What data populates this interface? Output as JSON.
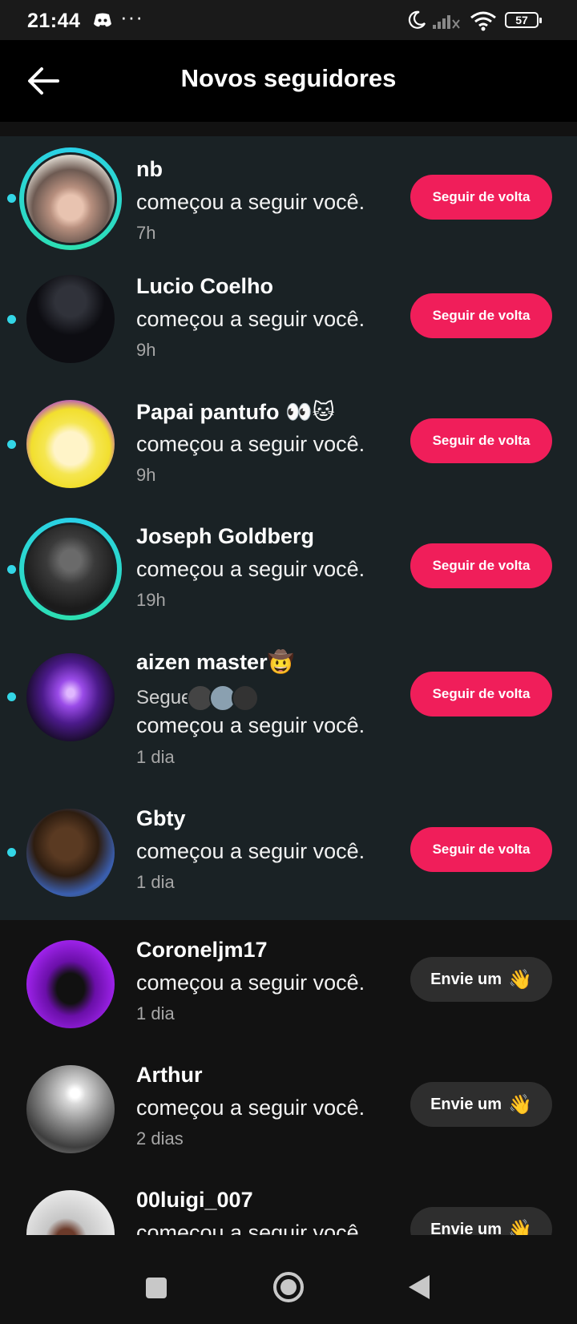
{
  "status_bar": {
    "time": "21:44",
    "battery": "57",
    "icons": [
      "discord-icon",
      "more-dots-icon",
      "moon-icon",
      "signal-icon",
      "wifi-icon",
      "battery-icon"
    ]
  },
  "header": {
    "title": "Novos seguidores",
    "back_icon": "arrow-left-icon"
  },
  "followers": [
    {
      "name": "nb",
      "desc": "começou a seguir você.",
      "time": "7h",
      "action": "Seguir de volta",
      "unread": true,
      "story_ring": true
    },
    {
      "name": "Lucio Coelho",
      "desc": "começou a seguir você.",
      "time": "9h",
      "action": "Seguir de volta",
      "unread": true,
      "story_ring": false
    },
    {
      "name": "Papai pantufo 👀🐱",
      "desc": "começou a seguir você.",
      "time": "9h",
      "action": "Seguir de volta",
      "unread": true,
      "story_ring": false
    },
    {
      "name": "Joseph Goldberg",
      "desc": "começou a seguir você.",
      "time": "19h",
      "action": "Seguir de volta",
      "unread": true,
      "story_ring": true
    },
    {
      "name": "aizen master🤠",
      "segue": "Segue",
      "desc": "começou a seguir você.",
      "time": "1 dia",
      "action": "Seguir de volta",
      "unread": true,
      "story_ring": false
    },
    {
      "name": "Gbty",
      "desc": "começou a seguir você.",
      "time": "1 dia",
      "action": "Seguir de volta",
      "unread": true,
      "story_ring": false
    },
    {
      "name": "Coroneljm17",
      "desc": "começou a seguir você.",
      "time": "1 dia",
      "action": "Envie um",
      "action_icon": "👋",
      "unread": false,
      "story_ring": false
    },
    {
      "name": "Arthur",
      "desc": "começou a seguir você.",
      "time": "2 dias",
      "action": "Envie um",
      "action_icon": "👋",
      "unread": false,
      "story_ring": false
    },
    {
      "name": "00luigi_007",
      "desc": "começou a seguir você.",
      "time": "",
      "action": "Envie um",
      "action_icon": "👋",
      "unread": false,
      "story_ring": false
    }
  ],
  "nav_bar": [
    "recents-square-icon",
    "home-circle-icon",
    "back-triangle-icon"
  ]
}
